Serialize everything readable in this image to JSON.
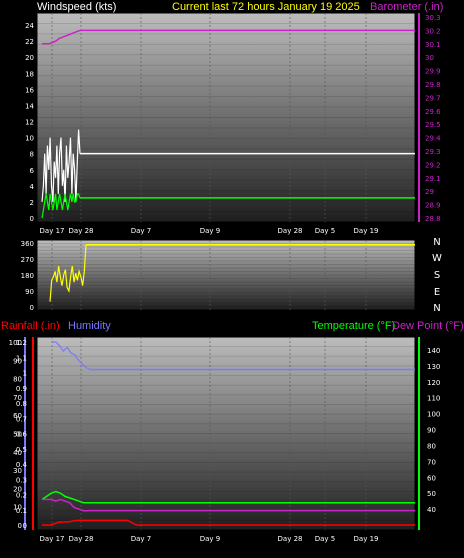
{
  "header": {
    "windspeed_label": "Windspeed (kts)",
    "current_label": "Current last 72 hours January 19 2025",
    "barometer_label": "Barometer (.in)"
  },
  "panel3": {
    "rainfall_label": "Rainfall (.in)",
    "humidity_label": "Humidity",
    "temperature_label": "Temperature (°F)",
    "dewpoint_label": "Dew Point (°F)"
  },
  "x_ticks": [
    "Day 17",
    "Day 28",
    "Day 7",
    "Day 9",
    "Day 28",
    "Day 5",
    "Day 19"
  ],
  "colors": {
    "wind_speed": "#ffffff",
    "wind_gust": "#ffffff",
    "wind_avg": "#00ff00",
    "barometer": "#cc22cc",
    "direction": "#ffff00",
    "rain": "#ff0000",
    "humidity": "#7777ff",
    "temperature": "#00ff00",
    "dewpoint": "#cc22cc"
  },
  "chart_data": [
    {
      "type": "line",
      "title": "Current last 72 hours January 19 2025",
      "ylabel": "Windspeed (kts)",
      "y2label": "Barometer (.in)",
      "ylim": [
        0,
        25
      ],
      "y2lim": [
        28.8,
        30.3
      ],
      "yticks": [
        "0",
        "2",
        "4",
        "6",
        "8",
        "10",
        "12",
        "14",
        "16",
        "18",
        "20",
        "22",
        "24"
      ],
      "y2ticks": [
        "28.8",
        "28.9",
        "29",
        "29.1",
        "29.2",
        "29.3",
        "29.4",
        "29.5",
        "29.6",
        "29.7",
        "29.8",
        "29.9",
        "30",
        "30.1",
        "30.2",
        "30.3"
      ],
      "grid": true,
      "series": [
        {
          "name": "wind speed",
          "values": [
            2,
            4,
            8,
            3,
            9,
            6,
            10,
            4,
            2,
            7,
            5,
            9,
            3,
            8,
            10,
            4,
            6,
            2,
            9,
            5,
            7,
            10,
            3,
            8,
            6,
            2,
            7,
            11,
            8,
            8,
            8
          ]
        },
        {
          "name": "average wind",
          "values": [
            0,
            1,
            2,
            3,
            2,
            1,
            3,
            2,
            1,
            2,
            3,
            1,
            2,
            3,
            2,
            1,
            2,
            3,
            2,
            1,
            2,
            3,
            2,
            3,
            2,
            2,
            3,
            3,
            2.5,
            2.5,
            2.5
          ]
        },
        {
          "name": "barometer",
          "values": [
            30.1,
            30.1,
            30.1,
            30.11,
            30.12,
            30.14,
            30.15,
            30.16,
            30.17,
            30.18,
            30.19,
            30.2,
            30.2,
            30.2,
            30.2,
            30.2,
            30.2,
            30.2,
            30.2,
            30.2
          ]
        }
      ]
    },
    {
      "type": "line",
      "ylim": [
        0,
        360
      ],
      "yticks": [
        "0",
        "90",
        "180",
        "270",
        "360"
      ],
      "y2ticks": [
        "N",
        "E",
        "S",
        "W",
        "N"
      ],
      "grid": true,
      "series": [
        {
          "name": "wind direction",
          "values": [
            30,
            150,
            170,
            200,
            140,
            230,
            170,
            120,
            180,
            210,
            110,
            90,
            170,
            230,
            140,
            190,
            150,
            200,
            170,
            120,
            200,
            350,
            350,
            350,
            350,
            350,
            350
          ]
        }
      ]
    },
    {
      "type": "line",
      "ylabel": "Rainfall (.in)",
      "y2label": "Temperature (°F) Dew Point (°F)",
      "ylim": [
        0,
        1.2
      ],
      "yticks": [
        "0",
        "0.1",
        "0.2",
        "0.3",
        "0.4",
        "0.5",
        "0.6",
        "0.7",
        "0.8",
        "0.9",
        "1",
        "1.1",
        "1.2"
      ],
      "humidity_ticks": [
        "0",
        "10",
        "20",
        "30",
        "40",
        "50",
        "60",
        "70",
        "80",
        "90",
        "100"
      ],
      "y2ticks": [
        "40",
        "50",
        "60",
        "70",
        "80",
        "90",
        "100",
        "110",
        "120",
        "130",
        "140"
      ],
      "grid": true,
      "series": [
        {
          "name": "rainfall",
          "values": [
            0,
            0,
            0.02,
            0.02,
            0.03,
            0.03,
            0.03,
            0.03,
            0.03,
            0.03,
            0.03,
            0,
            0,
            0,
            0,
            0,
            0,
            0,
            0,
            0
          ]
        },
        {
          "name": "humidity",
          "values": [
            100,
            100,
            98,
            95,
            97,
            94,
            93,
            90,
            88,
            86,
            85,
            85,
            85,
            85,
            85,
            85,
            85,
            85,
            85,
            85
          ]
        },
        {
          "name": "temperature",
          "values": [
            46,
            48,
            50,
            51,
            50,
            48,
            47,
            46,
            45,
            44,
            44,
            44,
            44,
            44,
            44,
            44,
            44,
            44,
            44,
            44
          ]
        },
        {
          "name": "dew point",
          "values": [
            46,
            46,
            46,
            45,
            46,
            45,
            44,
            41,
            40,
            39,
            39,
            39,
            39,
            39,
            39,
            39,
            39,
            39,
            39,
            39
          ]
        }
      ]
    }
  ]
}
